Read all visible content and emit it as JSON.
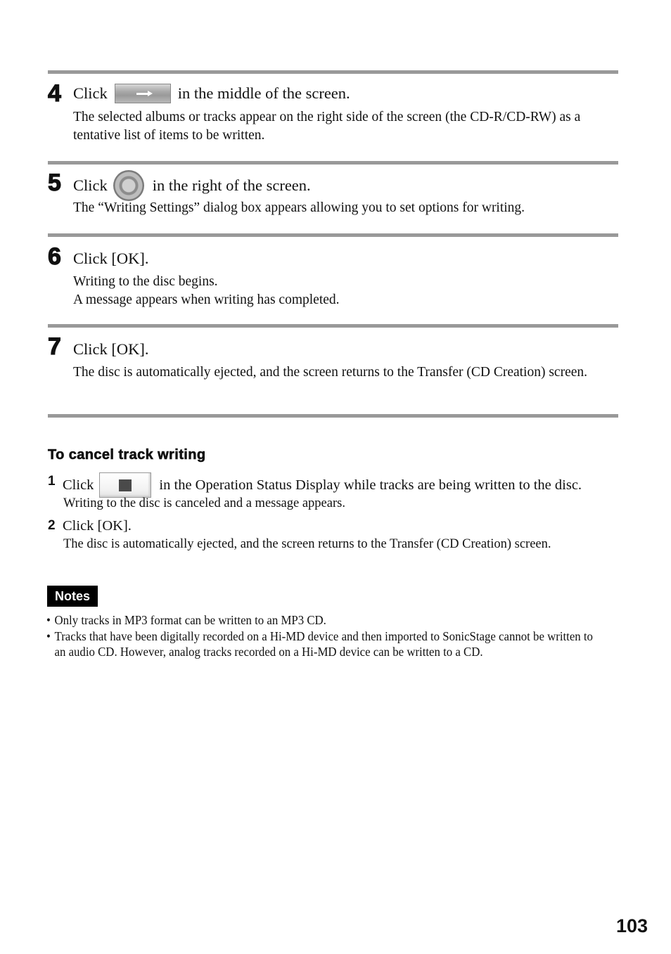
{
  "steps": [
    {
      "number": "4",
      "head_before": "Click",
      "icon": "arrow-right-button-icon",
      "head_after": "in the middle of the screen.",
      "body": "The selected albums or tracks appear on the right side of the screen (the CD-R/CD-RW) as a tentative list of items to be written."
    },
    {
      "number": "5",
      "head_before": "Click",
      "icon": "disc-write-button-icon",
      "head_after": "in the right of the screen.",
      "body": "The “Writing Settings” dialog box appears allowing you to set options for writing."
    },
    {
      "number": "6",
      "head": "Click [OK].",
      "body_lines": [
        "Writing to the disc begins.",
        "A message appears when writing has completed."
      ]
    },
    {
      "number": "7",
      "head": "Click [OK].",
      "body": "The disc is automatically ejected, and the screen returns to the Transfer (CD Creation) screen."
    }
  ],
  "cancel_section": {
    "title": "To cancel track writing",
    "steps": [
      {
        "number": "1",
        "head_before": "Click",
        "icon": "stop-button-icon",
        "head_after": "in the Operation Status Display while tracks are being written to the disc.",
        "body": "Writing to the disc is canceled and a message appears."
      },
      {
        "number": "2",
        "head": "Click [OK].",
        "body": "The disc is automatically ejected, and the screen returns to the Transfer (CD Creation) screen."
      }
    ]
  },
  "notes": {
    "label": "Notes",
    "items": [
      "Only tracks in MP3 format can be written to an MP3 CD.",
      "Tracks that have been digitally recorded on a Hi-MD device and then imported to SonicStage cannot be written to an audio CD. However, analog tracks recorded on a Hi-MD device can be written to a CD."
    ]
  },
  "page_number": "103"
}
